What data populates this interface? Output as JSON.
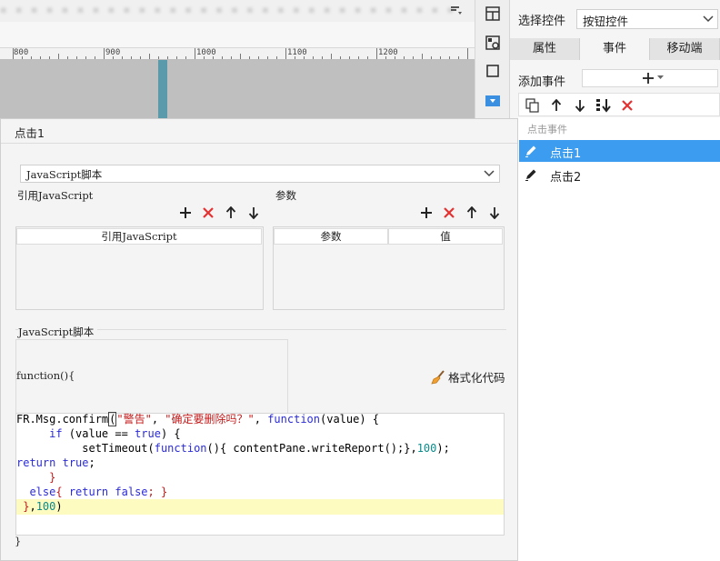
{
  "canvas": {
    "ruler_labels": [
      "800",
      "900",
      "1000",
      "1100",
      "1200"
    ]
  },
  "right_panel": {
    "select_label": "选择控件",
    "select_value": "按钮控件",
    "tabs": [
      {
        "label": "属性"
      },
      {
        "label": "事件"
      },
      {
        "label": "移动端"
      }
    ],
    "add_event_label": "添加事件",
    "event_group_label": "点击事件",
    "events": [
      {
        "label": "点击1",
        "selected": true
      },
      {
        "label": "点击2",
        "selected": false
      }
    ]
  },
  "dialog": {
    "title": "点击1",
    "type_select_value": "JavaScript脚本",
    "ref_js_label": "引用JavaScript",
    "params_label": "参数",
    "ref_js_table_header": "引用JavaScript",
    "params_table_headers": [
      "参数",
      "值"
    ],
    "script_label": "JavaScript脚本",
    "function_open": "function(){",
    "format_button_label": "格式化代码",
    "function_close": "}"
  },
  "code": {
    "line1": {
      "a": "FR.Msg.confirm",
      "b": "(",
      "c": "\"警告\"",
      "d": ", ",
      "e": "\"确定要删除吗？\"",
      "f": ", ",
      "g": "function",
      "h": "(value) {"
    },
    "line2": {
      "a": "     ",
      "b": "if",
      "c": " (value == ",
      "d": "true",
      "e": ") {"
    },
    "line3": {
      "a": "          setTimeout(",
      "b": "function",
      "c": "(){ contentPane.writeReport();},",
      "d": "100",
      "e": ");"
    },
    "line4": {
      "a": "return",
      "b": " ",
      "c": "true",
      "d": ";"
    },
    "line5": {
      "a": "     }"
    },
    "line6": {
      "a": "  else",
      "b": "{ ",
      "c": "return",
      "d": " ",
      "e": "false",
      "f": "; }"
    },
    "line7": {
      "a": " }",
      "b": ",",
      "c": "100",
      "d": ")"
    }
  },
  "colors": {
    "selected_event": "#3b9cf0",
    "delete_icon": "#e53030",
    "code_keyword": "#2b2bd8",
    "code_string": "#c31a1a",
    "highlight_line": "#fdfbc0"
  }
}
